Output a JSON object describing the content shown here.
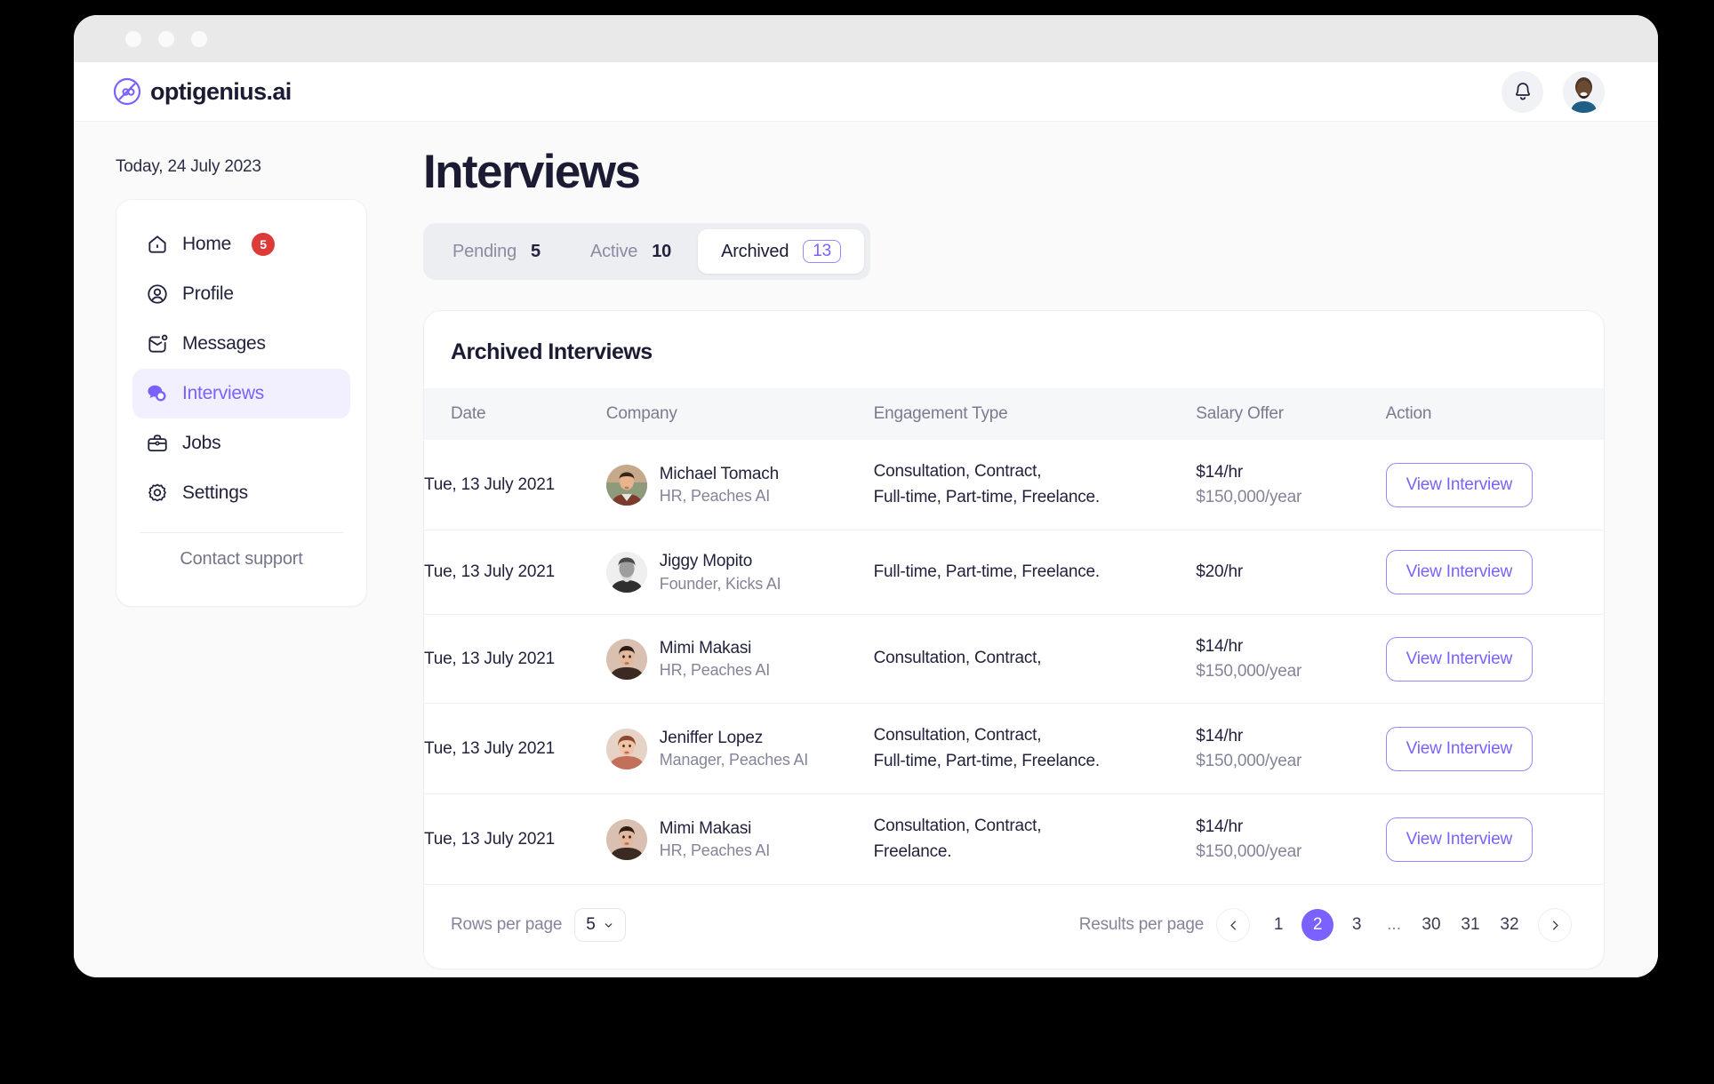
{
  "window": {
    "dots": [
      "close",
      "minimize",
      "maximize"
    ]
  },
  "header": {
    "brand": "optigenius.ai",
    "brand_icon": "infinity-logo-icon",
    "bell_icon": "bell-icon",
    "avatar_alt": "user-avatar"
  },
  "sidebar": {
    "today": "Today, 24 July 2023",
    "items": [
      {
        "label": "Home",
        "icon": "home-icon",
        "badge": "5",
        "active": false
      },
      {
        "label": "Profile",
        "icon": "profile-icon",
        "badge": "",
        "active": false
      },
      {
        "label": "Messages",
        "icon": "messages-icon",
        "badge": "",
        "active": false
      },
      {
        "label": "Interviews",
        "icon": "interviews-icon",
        "badge": "",
        "active": true
      },
      {
        "label": "Jobs",
        "icon": "jobs-icon",
        "badge": "",
        "active": false
      },
      {
        "label": "Settings",
        "icon": "settings-icon",
        "badge": "",
        "active": false
      }
    ],
    "support_label": "Contact support"
  },
  "main": {
    "page_title": "Interviews",
    "tabs": [
      {
        "label": "Pending",
        "count": "5",
        "active": false
      },
      {
        "label": "Active",
        "count": "10",
        "active": false
      },
      {
        "label": "Archived",
        "count": "13",
        "active": true
      }
    ],
    "card_title": "Archived Interviews",
    "columns": [
      "Date",
      "Company",
      "Engagement Type",
      "Salary Offer",
      "Action"
    ],
    "rows": [
      {
        "date": "Tue, 13 July 2021",
        "name": "Michael Tomach",
        "role": "HR, Peaches AI",
        "avatar": "avatar-michael",
        "engagement_line1": "Consultation, Contract,",
        "engagement_line2": "Full-time, Part-time, Freelance.",
        "salary_hourly": "$14/hr",
        "salary_yearly": "$150,000/year",
        "action": "View Interview"
      },
      {
        "date": "Tue, 13 July 2021",
        "name": "Jiggy Mopito",
        "role": "Founder, Kicks AI",
        "avatar": "avatar-jiggy",
        "engagement_line1": "Full-time, Part-time, Freelance.",
        "engagement_line2": "",
        "salary_hourly": "$20/hr",
        "salary_yearly": "",
        "action": "View Interview"
      },
      {
        "date": "Tue, 13 July 2021",
        "name": "Mimi Makasi",
        "role": "HR, Peaches AI",
        "avatar": "avatar-mimi",
        "engagement_line1": "Consultation, Contract,",
        "engagement_line2": "",
        "salary_hourly": "$14/hr",
        "salary_yearly": "$150,000/year",
        "action": "View Interview"
      },
      {
        "date": "Tue, 13 July 2021",
        "name": "Jeniffer Lopez",
        "role": "Manager, Peaches AI",
        "avatar": "avatar-jeniffer",
        "engagement_line1": "Consultation, Contract,",
        "engagement_line2": "Full-time, Part-time, Freelance.",
        "salary_hourly": "$14/hr",
        "salary_yearly": "$150,000/year",
        "action": "View Interview"
      },
      {
        "date": "Tue, 13 July 2021",
        "name": "Mimi Makasi",
        "role": "HR, Peaches AI",
        "avatar": "avatar-mimi2",
        "engagement_line1": "Consultation, Contract,",
        "engagement_line2": "Freelance.",
        "salary_hourly": "$14/hr",
        "salary_yearly": "$150,000/year",
        "action": "View Interview"
      }
    ],
    "pagination": {
      "rows_label": "Rows per page",
      "rows_value": "5",
      "results_label": "Results per page",
      "prev_icon": "chevron-left-icon",
      "next_icon": "chevron-right-icon",
      "pages": [
        "1",
        "2",
        "3",
        "...",
        "30",
        "31",
        "32"
      ],
      "current_page": "2"
    }
  },
  "colors": {
    "accent": "#7b61ff",
    "accent_soft": "#f2effe",
    "badge_red": "#dd3a3a",
    "text_dark": "#1b1b34",
    "text_muted": "#84849a",
    "page_bg": "#fafafa"
  }
}
